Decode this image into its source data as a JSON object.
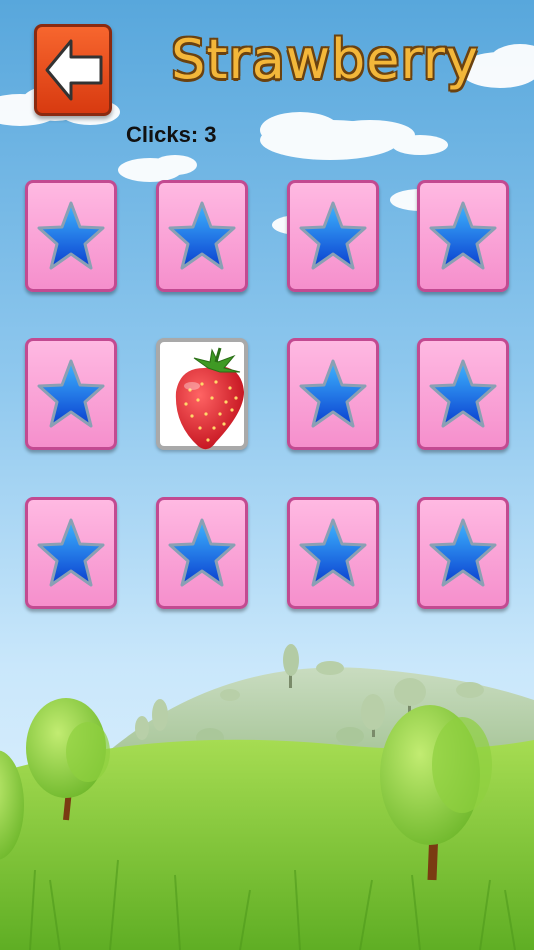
{
  "header": {
    "title": "Strawberry",
    "clicks_label": "Clicks:",
    "clicks_value": "3",
    "back_icon": "left-arrow-icon"
  },
  "board": {
    "rows": 3,
    "columns": 4,
    "cards": [
      {
        "row": 1,
        "col": 1,
        "state": "face-down",
        "icon": "star-icon"
      },
      {
        "row": 1,
        "col": 2,
        "state": "face-down",
        "icon": "star-icon"
      },
      {
        "row": 1,
        "col": 3,
        "state": "face-down",
        "icon": "star-icon"
      },
      {
        "row": 1,
        "col": 4,
        "state": "face-down",
        "icon": "star-icon"
      },
      {
        "row": 2,
        "col": 1,
        "state": "face-down",
        "icon": "star-icon"
      },
      {
        "row": 2,
        "col": 2,
        "state": "face-up",
        "icon": "strawberry-icon"
      },
      {
        "row": 2,
        "col": 3,
        "state": "face-down",
        "icon": "star-icon"
      },
      {
        "row": 2,
        "col": 4,
        "state": "face-down",
        "icon": "star-icon"
      },
      {
        "row": 3,
        "col": 1,
        "state": "face-down",
        "icon": "star-icon"
      },
      {
        "row": 3,
        "col": 2,
        "state": "face-down",
        "icon": "star-icon"
      },
      {
        "row": 3,
        "col": 3,
        "state": "face-down",
        "icon": "star-icon"
      },
      {
        "row": 3,
        "col": 4,
        "state": "face-down",
        "icon": "star-icon"
      }
    ]
  },
  "colors": {
    "card_back": "#f9a5d8",
    "star": "#1f6fe0",
    "back_button": "#e84d1c",
    "title_fill": "#f3b73a",
    "grass": "#7fc63a"
  }
}
